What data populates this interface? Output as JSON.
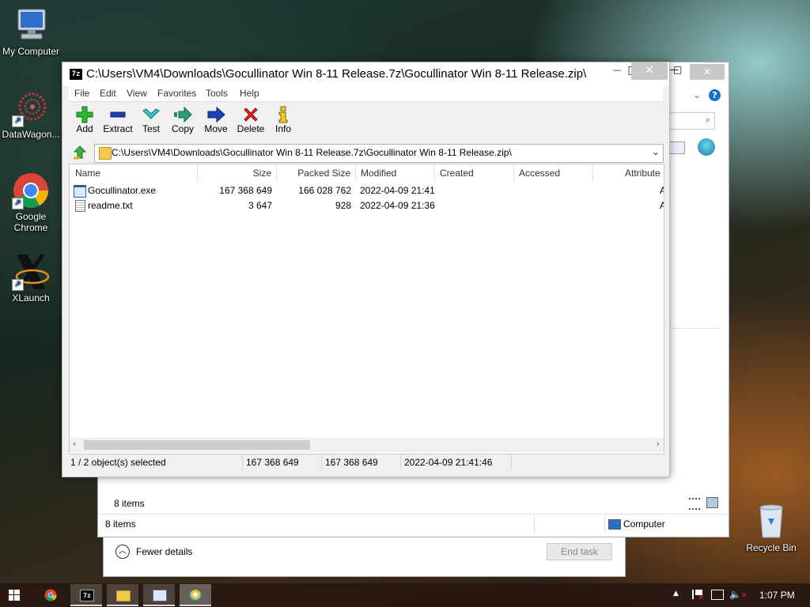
{
  "desktop": {
    "icons": [
      {
        "label": "My Computer",
        "icon": "my-computer-icon"
      },
      {
        "label": "DataWagon...",
        "icon": "datawagon-icon"
      },
      {
        "label": "Google Chrome",
        "icon": "chrome-icon"
      },
      {
        "label": "XLaunch",
        "icon": "xlaunch-icon"
      },
      {
        "label": "Recycle Bin",
        "icon": "recycle-bin-icon"
      }
    ]
  },
  "back_window": {
    "items_label_1": "8 items",
    "items_label_2": "8 items",
    "computer_label": "Computer"
  },
  "task_manager": {
    "fewer_details": "Fewer details",
    "end_task": "End task"
  },
  "window": {
    "title": "C:\\Users\\VM4\\Downloads\\Gocullinator Win 8-11 Release.7z\\Gocullinator Win 8-11 Release.zip\\",
    "app_icon_text": "7z",
    "minimize": "—",
    "maximize": "□",
    "close": "✕"
  },
  "menu": [
    "File",
    "Edit",
    "View",
    "Favorites",
    "Tools",
    "Help"
  ],
  "toolbar": {
    "add": "Add",
    "extract": "Extract",
    "test": "Test",
    "copy": "Copy",
    "move": "Move",
    "delete": "Delete",
    "info": "Info"
  },
  "address": {
    "path": "C:\\Users\\VM4\\Downloads\\Gocullinator Win 8-11 Release.7z\\Gocullinator Win 8-11 Release.zip\\"
  },
  "columns": [
    "Name",
    "Size",
    "Packed Size",
    "Modified",
    "Created",
    "Accessed",
    "Attribute"
  ],
  "files": [
    {
      "name": "Gocullinator.exe",
      "size": "167 368 649",
      "packed": "166 028 762",
      "modified": "2022-04-09 21:41",
      "attr": "A"
    },
    {
      "name": "readme.txt",
      "size": "3 647",
      "packed": "928",
      "modified": "2022-04-09 21:36",
      "attr": "A"
    }
  ],
  "status": {
    "selected": "1 / 2 object(s) selected",
    "size": "167 368 649",
    "packed": "167 368 649",
    "modified": "2022-04-09 21:41:46"
  },
  "taskbar": {
    "time": "1:07 PM",
    "tray_expand": "▲"
  }
}
